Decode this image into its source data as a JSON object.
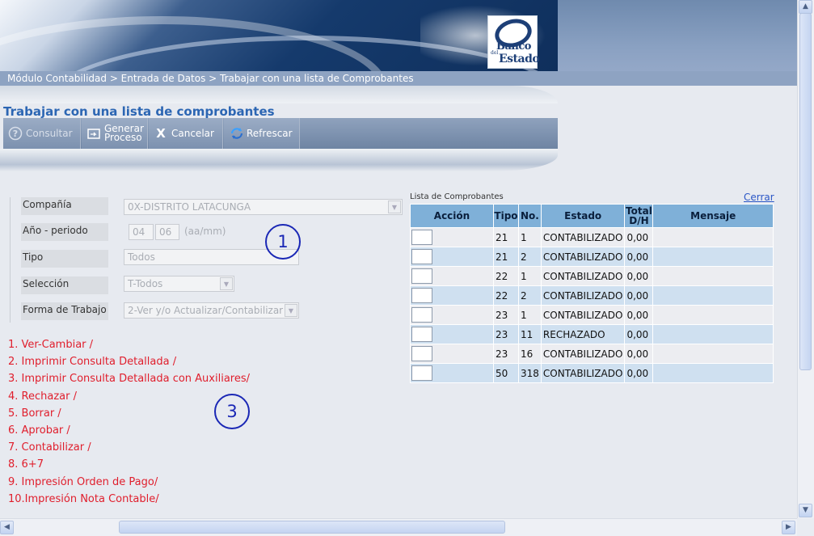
{
  "breadcrumb": "Módulo Contabilidad > Entrada de Datos > Trabajar con una lista de Comprobantes",
  "logo": {
    "line1": "Banco",
    "line2": "del",
    "line3": "Estado"
  },
  "page_title": "Trabajar con una lista de comprobantes",
  "toolbar": {
    "consultar": "Consultar",
    "generar_line1": "Generar",
    "generar_line2": "Proceso",
    "cancelar": "Cancelar",
    "refrescar": "Refrescar"
  },
  "form": {
    "compania_label": "Compañía",
    "compania_value": "0X-DISTRITO LATACUNGA",
    "anio_label": "Año - periodo",
    "anio_value": "04",
    "periodo_value": "06",
    "anio_hint": "(aa/mm)",
    "tipo_label": "Tipo",
    "tipo_value": "Todos",
    "seleccion_label": "Selección",
    "seleccion_value": "T-Todos",
    "forma_label": "Forma de Trabajo",
    "forma_value": "2-Ver y/o Actualizar/Contabilizar"
  },
  "options": [
    "1. Ver-Cambiar /",
    "2. Imprimir Consulta Detallada /",
    "3. Imprimir Consulta Detallada con Auxiliares/",
    "4. Rechazar /",
    "5. Borrar /",
    "6. Aprobar /",
    "7. Contabilizar /",
    "8. 6+7",
    "9. Impresión Orden de Pago/",
    "10.Impresión Nota Contable/"
  ],
  "markers": {
    "one": "1",
    "two": "2",
    "three": "3"
  },
  "list": {
    "title": "Lista de Comprobantes",
    "close_link": "Cerrar",
    "headers": {
      "accion": "Acción",
      "tipo": "Tipo",
      "no": "No.",
      "estado": "Estado",
      "total1": "Total",
      "total2": "D/H",
      "mensaje": "Mensaje"
    },
    "rows": [
      {
        "tipo": "21",
        "no": "1",
        "estado": "CONTABILIZADO",
        "total": "0,00",
        "mensaje": ""
      },
      {
        "tipo": "21",
        "no": "2",
        "estado": "CONTABILIZADO",
        "total": "0,00",
        "mensaje": ""
      },
      {
        "tipo": "22",
        "no": "1",
        "estado": "CONTABILIZADO",
        "total": "0,00",
        "mensaje": ""
      },
      {
        "tipo": "22",
        "no": "2",
        "estado": "CONTABILIZADO",
        "total": "0,00",
        "mensaje": ""
      },
      {
        "tipo": "23",
        "no": "1",
        "estado": "CONTABILIZADO",
        "total": "0,00",
        "mensaje": ""
      },
      {
        "tipo": "23",
        "no": "11",
        "estado": "RECHAZADO",
        "total": "0,00",
        "mensaje": ""
      },
      {
        "tipo": "23",
        "no": "16",
        "estado": "CONTABILIZADO",
        "total": "0,00",
        "mensaje": ""
      },
      {
        "tipo": "50",
        "no": "318",
        "estado": "CONTABILIZADO",
        "total": "0,00",
        "mensaje": ""
      }
    ]
  },
  "icons": {
    "consultar": "help-circle-icon",
    "generar": "process-icon",
    "cancelar": "x-icon",
    "refrescar": "refresh-icon"
  }
}
